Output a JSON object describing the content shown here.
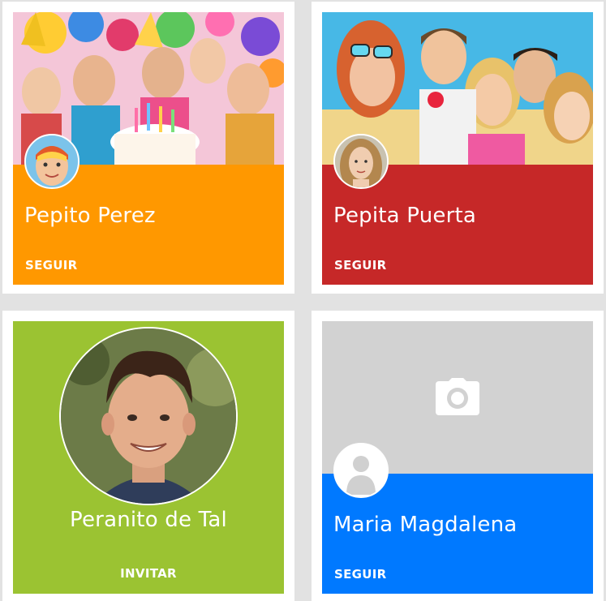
{
  "cards": [
    {
      "name": "Pepito Perez",
      "action": "SEGUIR",
      "accent": "#ff9800",
      "cover": "birthday-party-kids-photo",
      "avatar": "boy-face-paint-avatar"
    },
    {
      "name": "Pepita Puerta",
      "action": "SEGUIR",
      "accent": "#c62828",
      "cover": "friends-group-party-photo",
      "avatar": "girl-portrait-avatar"
    },
    {
      "name": "Peranito de Tal",
      "action": "INVITAR",
      "accent": "#9bc332",
      "avatar": "young-man-portrait-avatar"
    },
    {
      "name": "Maria Magdalena",
      "action": "SEGUIR",
      "accent": "#0079ff",
      "cover": "camera-icon",
      "avatar": "default-user-icon"
    }
  ]
}
